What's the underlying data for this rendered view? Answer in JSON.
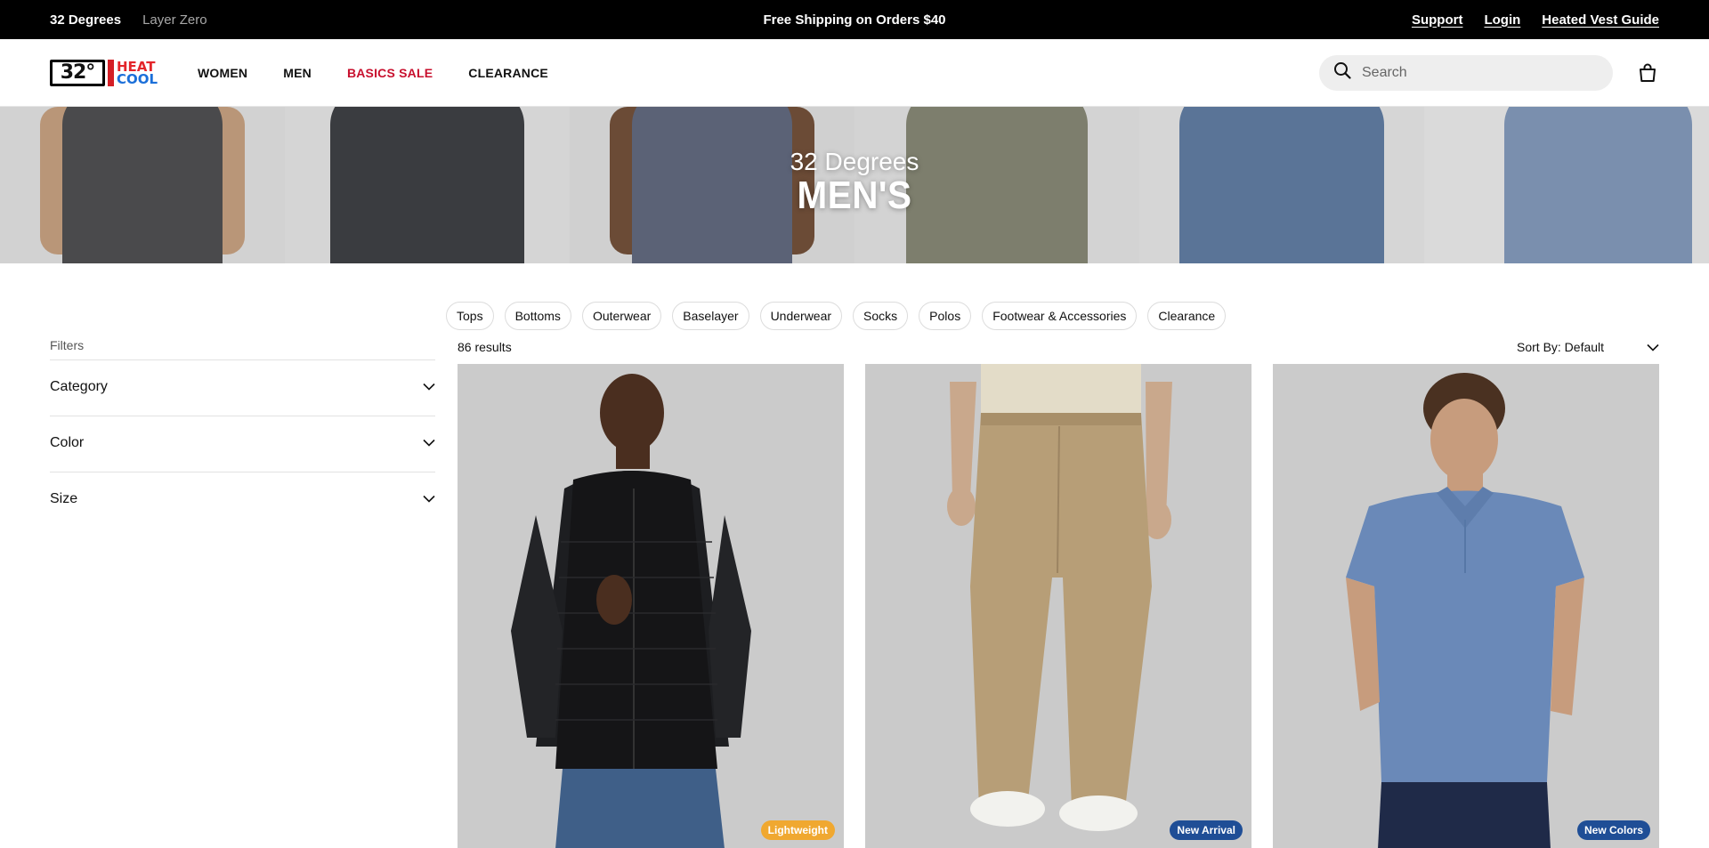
{
  "topbar": {
    "brands": [
      "32 Degrees",
      "Layer Zero"
    ],
    "promo": "Free Shipping on Orders $40",
    "links": [
      "Support",
      "Login",
      "Heated Vest Guide"
    ]
  },
  "nav": {
    "logo": {
      "mark": "32°",
      "heat": "HEAT",
      "cool": "COOL"
    },
    "menu": [
      "WOMEN",
      "MEN",
      "BASICS SALE",
      "CLEARANCE"
    ],
    "search_placeholder": "Search",
    "cart_count": ""
  },
  "hero": {
    "subtitle": "32 Degrees",
    "title": "MEN'S",
    "panels": [
      {
        "name": "charcoal-tee",
        "color": "#4a4a4c"
      },
      {
        "name": "dark-quarter-zip",
        "color": "#3a3c40"
      },
      {
        "name": "slate-polo",
        "color": "#5b6276"
      },
      {
        "name": "olive-hoodie",
        "color": "#7d7e6d"
      },
      {
        "name": "blue-long-sleeve",
        "color": "#5a7497"
      },
      {
        "name": "light-blue-hoodie",
        "color": "#7a8fae"
      }
    ]
  },
  "category_chips": [
    "Tops",
    "Bottoms",
    "Outerwear",
    "Baselayer",
    "Underwear",
    "Socks",
    "Polos",
    "Footwear & Accessories",
    "Clearance"
  ],
  "filters": {
    "label": "Filters",
    "facets": [
      "Category",
      "Color",
      "Size"
    ]
  },
  "results_count": "86 results",
  "sort": "Sort By: Default",
  "products": [
    {
      "badge": "Lightweight",
      "badge_color": "#f0a830"
    },
    {
      "badge": "New Arrival",
      "badge_color": "#1f4e96"
    },
    {
      "badge": "New Colors",
      "badge_color": "#1f4e96"
    }
  ],
  "colors": {
    "accent_sale": "#c8102e",
    "topbar_bg": "#000000",
    "product_bg": "#c9c9c9"
  }
}
